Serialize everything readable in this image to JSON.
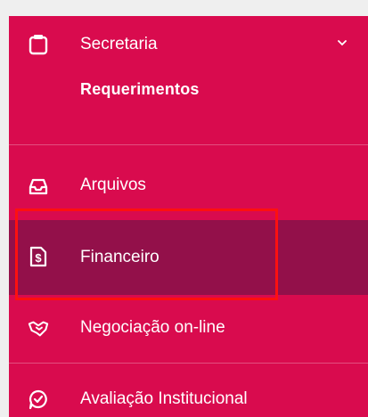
{
  "sidebar": {
    "sections": {
      "secretaria": {
        "label": "Secretaria",
        "icon": "clipboard-icon",
        "chevron": "chevron-down-icon",
        "subitems": [
          {
            "label": "Requerimentos"
          }
        ]
      }
    },
    "items": [
      {
        "label": "Arquivos",
        "icon": "inbox-icon"
      },
      {
        "label": "Financeiro",
        "icon": "dollar-document-icon",
        "active": true
      },
      {
        "label": "Negociação on-line",
        "icon": "handshake-icon"
      },
      {
        "label": "Avaliação Institucional",
        "icon": "chat-check-icon"
      }
    ]
  },
  "colors": {
    "sidebar_bg": "#d90b4e",
    "active_bg": "#93104a",
    "highlight": "#ff1010",
    "text": "#ffffff",
    "page_bg": "#efefef"
  }
}
